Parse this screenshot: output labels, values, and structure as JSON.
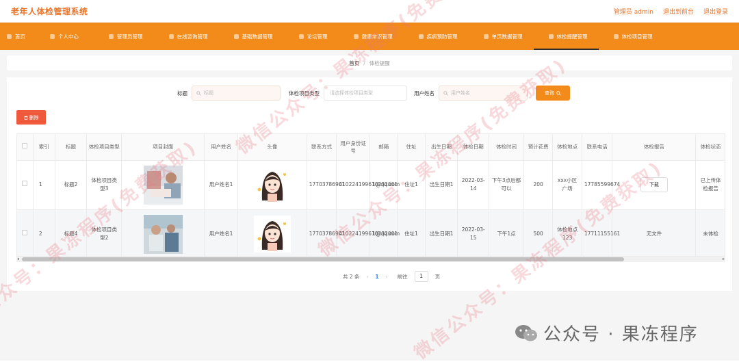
{
  "header": {
    "app_title": "老年人体检管理系统",
    "links": [
      "管理员 admin",
      "退出到前台",
      "退出登录"
    ]
  },
  "nav": {
    "items": [
      {
        "label": "首页",
        "icon": "home-icon"
      },
      {
        "label": "个人中心",
        "icon": "user-icon"
      },
      {
        "label": "管理员管理",
        "icon": "admin-icon"
      },
      {
        "label": "在线咨询管理",
        "icon": "chat-icon"
      },
      {
        "label": "基础数据管理",
        "icon": "database-icon"
      },
      {
        "label": "论坛管理",
        "icon": "forum-icon"
      },
      {
        "label": "健康常识管理",
        "icon": "health-icon"
      },
      {
        "label": "疾病预防管理",
        "icon": "shield-icon"
      },
      {
        "label": "单页数据管理",
        "icon": "page-icon"
      },
      {
        "label": "体检提醒管理",
        "icon": "bell-icon",
        "active": true
      },
      {
        "label": "体检项目管理",
        "icon": "list-icon"
      }
    ]
  },
  "breadcrumb": {
    "home": "首页",
    "separator": "/",
    "current": "体检提醒"
  },
  "search": {
    "title_label": "标题",
    "title_placeholder": "标题",
    "type_label": "体检项目类型",
    "type_placeholder": "请选择体检项目类型",
    "user_label": "用户姓名",
    "user_placeholder": "用户姓名",
    "search_button": "查询"
  },
  "toolbar": {
    "delete_button": "删除"
  },
  "table": {
    "headers": [
      "索引",
      "标题",
      "体检项目类型",
      "项目封面",
      "用户姓名",
      "头像",
      "联系方式",
      "用户身份证号",
      "邮箱",
      "住址",
      "出生日期",
      "体检日期",
      "体检时间",
      "预计花费",
      "体检地点",
      "联系电话",
      "体检报告",
      "体检状态"
    ],
    "rows": [
      {
        "index": "1",
        "title": "标题2",
        "type": "体检项目类型3",
        "user": "用户姓名1",
        "phone": "17703786901",
        "idcard": "410224199610232001",
        "email": "1@qq.com",
        "address": "住址1",
        "birth": "出生日期1",
        "date": "2022-03-14",
        "time": "下午3点后都可以",
        "cost": "200",
        "place": "xxx小区广场",
        "tel": "17785599674",
        "report": "下载",
        "status": "已上传体检报告"
      },
      {
        "index": "2",
        "title": "标题4",
        "type": "体检项目类型2",
        "user": "用户姓名1",
        "phone": "17703786901",
        "idcard": "410224199610232001",
        "email": "1@qq.com",
        "address": "住址1",
        "birth": "出生日期1",
        "date": "2022-03-15",
        "time": "下午1点",
        "cost": "500",
        "place": "体检地点123",
        "tel": "17711155161",
        "report": "无文件",
        "status": "未体检"
      }
    ]
  },
  "pager": {
    "total": "共 2 条",
    "current_page": "1",
    "goto_label": "前往",
    "goto_value": "1",
    "page_suffix": "页"
  },
  "watermark": {
    "brand": "公众号 · 果冻程序",
    "diagonal": "微信公众号：果冻程序(免费获取)"
  },
  "colors": {
    "accent": "#f38b1a",
    "title": "#e8742a",
    "danger": "#f05a3c"
  }
}
